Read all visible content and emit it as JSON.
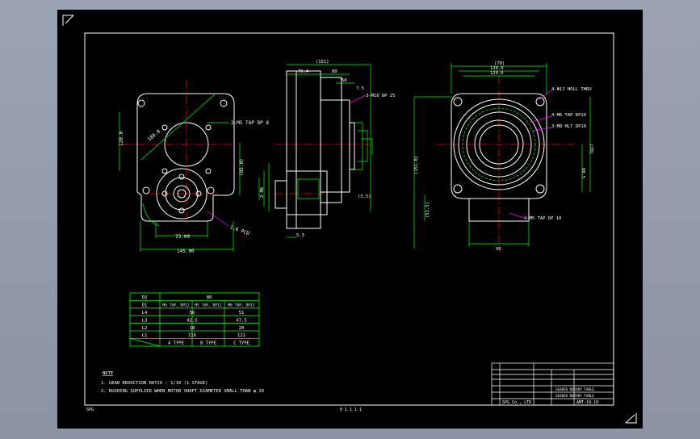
{
  "colors": {
    "background": "#000000",
    "frame": "#ffffff",
    "outline": "#ffffff",
    "dimension": "#00ff00",
    "centerline": "#ff0000",
    "leader": "#ff00ff",
    "text": "#ffffff",
    "table": "#00ff00"
  },
  "left_view": {
    "dims": {
      "top": "2-M5 TAP DP 8",
      "diag": "180.0",
      "left": "120.0",
      "right": "(85.0)",
      "bottom1": "73.00",
      "bottom2": "145.00",
      "callout": "1.6 PCD"
    }
  },
  "middle_view": {
    "dims": {
      "overall": "(151)",
      "a": "76.4",
      "b": "80",
      "c": "50",
      "d": "7.5",
      "e": "3-M10 DP 25",
      "f": "2-M6",
      "g": "(3.5)",
      "h": "5.3"
    }
  },
  "right_view": {
    "dims": {
      "top1": "(70)",
      "top2": "130.0",
      "top3": "120.0",
      "n1": "4-Φ11 HOLL THRU",
      "n2": "4-M6 TAP DP10",
      "n3": "3-M8 HLT DP10",
      "n4": "4-M5 TAP DP 10",
      "left1": "(151.0)",
      "left2": "(51.5)",
      "right1": "(70)",
      "right2": "80.5",
      "bottom": "90"
    }
  },
  "table": {
    "rows": [
      [
        "D2",
        "80",
        "",
        ""
      ],
      [
        "D1",
        "M6 TAP, DP12",
        "M5 TAP, DP12",
        "M6 TAP, DP12"
      ],
      [
        "L4",
        "56",
        "",
        "51"
      ],
      [
        "L3",
        "42.5",
        "",
        "47.5"
      ],
      [
        "L2",
        "18",
        "",
        "20"
      ],
      [
        "L1",
        "116",
        "",
        "121"
      ],
      [
        "",
        "A TYPE",
        "B TYPE",
        "C TYPE"
      ]
    ]
  },
  "notes": {
    "heading": "NOTE",
    "n1": "1. GEAR REDUCTION RATIO : 1/10  (1 STAGE)",
    "n2": "2. BUSHING SUPPLIED WHEN MOTOR SHAFT DIAMETER SMALL THAN φ 19"
  },
  "title_block": {
    "name1": "GEARED ROTARY TABLE",
    "name2": "GEARED ROTARY TABLE",
    "company": "SPG Co., LTD",
    "drawing_no": "AMT-10-10"
  },
  "footer": {
    "left": "SPG",
    "center": "0 1 1 1 1"
  }
}
